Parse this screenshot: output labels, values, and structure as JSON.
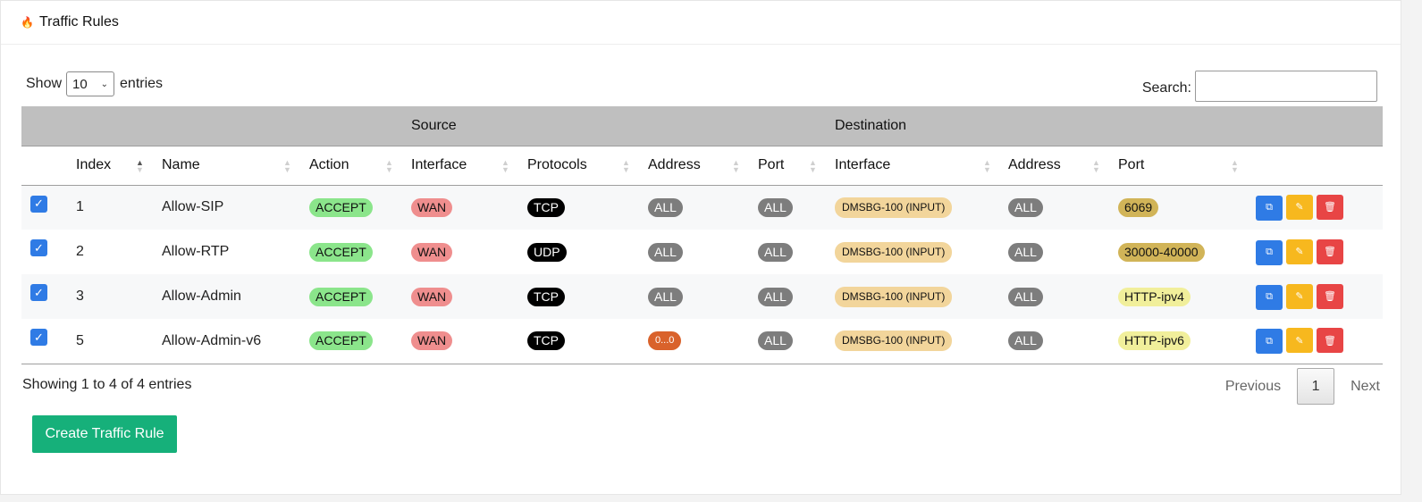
{
  "header": {
    "title": "Traffic Rules",
    "icon": "fire-icon"
  },
  "length_control": {
    "show_label": "Show",
    "selected": "10",
    "entries_label": "entries"
  },
  "search": {
    "label": "Search:",
    "value": "",
    "placeholder": ""
  },
  "table": {
    "group_headers": {
      "source": "Source",
      "destination": "Destination"
    },
    "columns": {
      "index": "Index",
      "name": "Name",
      "action": "Action",
      "src_interface": "Interface",
      "protocols": "Protocols",
      "src_address": "Address",
      "src_port": "Port",
      "dst_interface": "Interface",
      "dst_address": "Address",
      "dst_port": "Port"
    },
    "rows": [
      {
        "index": "1",
        "name": "Allow-SIP",
        "action": "ACCEPT",
        "src_interface": "WAN",
        "protocol": "TCP",
        "src_address": "ALL",
        "src_port": "ALL",
        "dst_interface": "DMSBG-100 (INPUT)",
        "dst_address": "ALL",
        "dst_port": "6069"
      },
      {
        "index": "2",
        "name": "Allow-RTP",
        "action": "ACCEPT",
        "src_interface": "WAN",
        "protocol": "UDP",
        "src_address": "ALL",
        "src_port": "ALL",
        "dst_interface": "DMSBG-100 (INPUT)",
        "dst_address": "ALL",
        "dst_port": "30000-40000"
      },
      {
        "index": "3",
        "name": "Allow-Admin",
        "action": "ACCEPT",
        "src_interface": "WAN",
        "protocol": "TCP",
        "src_address": "ALL",
        "src_port": "ALL",
        "dst_interface": "DMSBG-100 (INPUT)",
        "dst_address": "ALL",
        "dst_port": "HTTP-ipv4"
      },
      {
        "index": "5",
        "name": "Allow-Admin-v6",
        "action": "ACCEPT",
        "src_interface": "WAN",
        "protocol": "TCP",
        "src_address": "0...0",
        "src_port": "ALL",
        "dst_interface": "DMSBG-100 (INPUT)",
        "dst_address": "ALL",
        "dst_port": "HTTP-ipv6"
      }
    ]
  },
  "footer": {
    "info": "Showing 1 to 4 of 4 entries",
    "previous": "Previous",
    "page": "1",
    "next": "Next"
  },
  "create_button": "Create Traffic Rule",
  "colors": {
    "accept": "#8be58b",
    "wan": "#ef8e8e",
    "all": "#7d7d7d",
    "interface": "#f2d59b",
    "create": "#16b07a",
    "checkbox": "#2f7be5"
  }
}
